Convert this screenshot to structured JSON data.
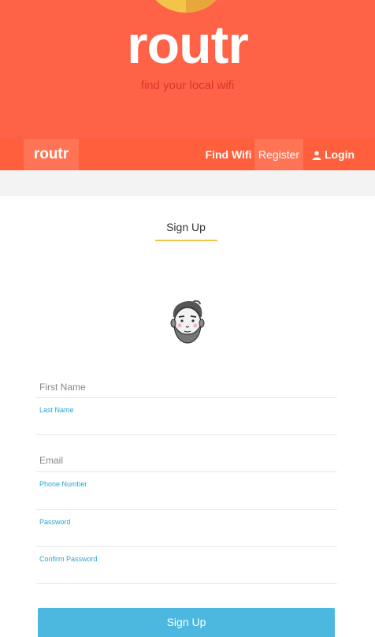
{
  "hero": {
    "title": "routr",
    "tagline": "find your local wifi"
  },
  "navbar": {
    "brand": "routr",
    "items": [
      {
        "label": "Find Wifi"
      },
      {
        "label": "Register"
      },
      {
        "label": "Login",
        "icon": "person-icon"
      }
    ]
  },
  "form": {
    "heading": "Sign Up",
    "avatar_icon": "avatar-icon",
    "fields": {
      "first_name": {
        "placeholder": "First Name"
      },
      "last_name": {
        "label": "Last Name"
      },
      "email": {
        "placeholder": "Email"
      },
      "phone": {
        "label": "Phone Number"
      },
      "password": {
        "label": "Password"
      },
      "confirm_password": {
        "label": "Confirm Password"
      }
    },
    "submit_label": "Sign Up"
  },
  "colors": {
    "primary": "#ff6347",
    "accent": "#f4c44a",
    "link": "#2aa3d6",
    "button": "#4cb8e0"
  }
}
